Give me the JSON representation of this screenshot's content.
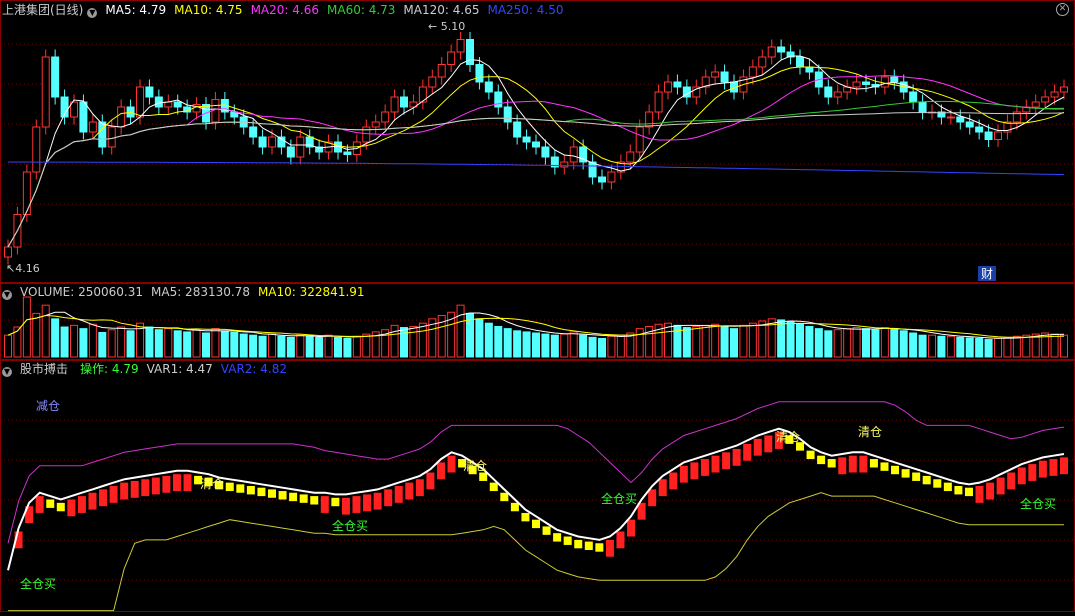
{
  "colors": {
    "up": "#ff3333",
    "down": "#54ffff",
    "ma5": "#ffffff",
    "ma10": "#ffff00",
    "ma20": "#ff33ff",
    "ma60": "#33cc33",
    "ma120": "#cccccc",
    "ma250": "#3344ff",
    "grid": "#880000",
    "buy": "#33ff33",
    "sell": "#ffff66",
    "reduce": "#8888ff"
  },
  "main": {
    "title": "上港集团(日线)",
    "legend": [
      {
        "label": "MA5: 4.79",
        "color": "#ffffff"
      },
      {
        "label": "MA10: 4.75",
        "color": "#ffff00"
      },
      {
        "label": "MA20: 4.66",
        "color": "#ff33ff"
      },
      {
        "label": "MA60: 4.73",
        "color": "#33cc33"
      },
      {
        "label": "MA120: 4.65",
        "color": "#cccccc"
      },
      {
        "label": "MA250: 4.50",
        "color": "#3344ff"
      }
    ],
    "high_label": "5.10",
    "low_label": "4.16",
    "finance_badge": "财"
  },
  "volume": {
    "legend": [
      {
        "label": "VOLUME: 250060.31",
        "color": "#cccccc"
      },
      {
        "label": "MA5: 283130.78",
        "color": "#cccccc"
      },
      {
        "label": "MA10: 322841.91",
        "color": "#ffff00"
      }
    ]
  },
  "indicator": {
    "title": "股市搏击",
    "legend": [
      {
        "label": "操作: 4.79",
        "color": "#33ff33"
      },
      {
        "label": "VAR1: 4.47",
        "color": "#cccccc"
      },
      {
        "label": "VAR2: 4.82",
        "color": "#3344ff"
      }
    ],
    "signals": {
      "reduce": "减仓",
      "clear": "清仓",
      "buy": "全仓买"
    }
  },
  "chart_data": {
    "type": "candlestick",
    "y_range": [
      4.16,
      5.1
    ],
    "closes": [
      4.22,
      4.35,
      4.52,
      4.7,
      4.98,
      4.82,
      4.74,
      4.8,
      4.68,
      4.72,
      4.62,
      4.7,
      4.78,
      4.74,
      4.86,
      4.82,
      4.78,
      4.8,
      4.78,
      4.76,
      4.79,
      4.72,
      4.81,
      4.76,
      4.74,
      4.7,
      4.66,
      4.62,
      4.66,
      4.62,
      4.58,
      4.66,
      4.62,
      4.6,
      4.64,
      4.6,
      4.59,
      4.64,
      4.7,
      4.72,
      4.76,
      4.82,
      4.78,
      4.8,
      4.86,
      4.9,
      4.95,
      5.0,
      5.05,
      4.95,
      4.88,
      4.84,
      4.78,
      4.72,
      4.66,
      4.64,
      4.62,
      4.58,
      4.54,
      4.56,
      4.62,
      4.56,
      4.5,
      4.48,
      4.52,
      4.56,
      4.6,
      4.7,
      4.76,
      4.84,
      4.88,
      4.86,
      4.82,
      4.86,
      4.9,
      4.92,
      4.88,
      4.84,
      4.9,
      4.94,
      4.98,
      5.02,
      5.0,
      4.98,
      4.94,
      4.92,
      4.86,
      4.82,
      4.84,
      4.86,
      4.88,
      4.87,
      4.86,
      4.9,
      4.88,
      4.84,
      4.8,
      4.76,
      4.76,
      4.74,
      4.74,
      4.72,
      4.7,
      4.68,
      4.65,
      4.68,
      4.72,
      4.76,
      4.78,
      4.8,
      4.82,
      4.84,
      4.86
    ],
    "volumes": [
      40,
      55,
      110,
      80,
      95,
      70,
      55,
      58,
      52,
      60,
      45,
      50,
      55,
      48,
      62,
      55,
      50,
      52,
      48,
      46,
      50,
      44,
      52,
      47,
      45,
      42,
      40,
      38,
      42,
      38,
      36,
      40,
      38,
      36,
      40,
      36,
      34,
      38,
      42,
      46,
      50,
      58,
      54,
      56,
      62,
      70,
      76,
      82,
      95,
      80,
      70,
      62,
      56,
      52,
      48,
      46,
      44,
      42,
      40,
      42,
      46,
      40,
      36,
      34,
      38,
      40,
      44,
      52,
      56,
      60,
      62,
      58,
      54,
      56,
      58,
      60,
      56,
      52,
      58,
      62,
      66,
      70,
      68,
      64,
      60,
      56,
      52,
      48,
      50,
      52,
      54,
      52,
      50,
      54,
      52,
      48,
      44,
      40,
      40,
      38,
      38,
      36,
      35,
      34,
      32,
      34,
      36,
      38,
      40,
      42,
      44,
      42,
      40
    ],
    "var_line": [
      4.2,
      4.45,
      4.6,
      4.66,
      4.64,
      4.62,
      4.64,
      4.66,
      4.68,
      4.7,
      4.72,
      4.74,
      4.75,
      4.76,
      4.77,
      4.78,
      4.79,
      4.79,
      4.78,
      4.77,
      4.75,
      4.74,
      4.73,
      4.72,
      4.71,
      4.7,
      4.69,
      4.68,
      4.67,
      4.66,
      4.66,
      4.65,
      4.65,
      4.66,
      4.67,
      4.68,
      4.7,
      4.72,
      4.74,
      4.76,
      4.8,
      4.86,
      4.9,
      4.88,
      4.84,
      4.8,
      4.74,
      4.68,
      4.62,
      4.56,
      4.52,
      4.48,
      4.44,
      4.42,
      4.4,
      4.39,
      4.38,
      4.4,
      4.45,
      4.52,
      4.62,
      4.7,
      4.76,
      4.8,
      4.84,
      4.86,
      4.88,
      4.9,
      4.92,
      4.94,
      4.97,
      5.0,
      5.02,
      5.04,
      5.02,
      4.98,
      4.93,
      4.9,
      4.88,
      4.89,
      4.9,
      4.9,
      4.88,
      4.86,
      4.84,
      4.82,
      4.8,
      4.78,
      4.76,
      4.74,
      4.72,
      4.71,
      4.72,
      4.74,
      4.77,
      4.8,
      4.83,
      4.85,
      4.87,
      4.88,
      4.89
    ]
  }
}
